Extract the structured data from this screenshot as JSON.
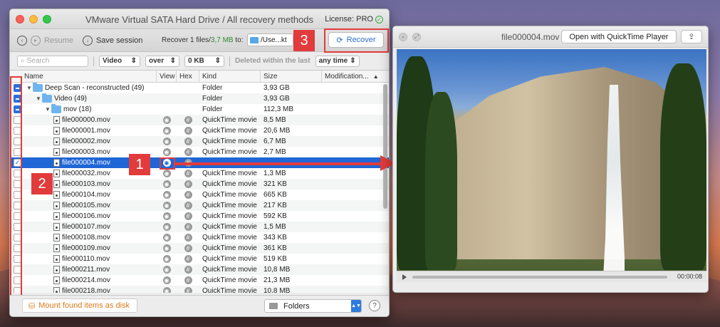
{
  "window": {
    "title": "VMware Virtual SATA Hard Drive / All recovery methods",
    "license": "License: PRO"
  },
  "toolbar": {
    "resume": "Resume",
    "save_session": "Save session",
    "recover_prefix": "Recover 1 files/",
    "recover_size": "3,7 MB",
    "recover_suffix": " to:",
    "path": "/Use...kt",
    "recover_button": "Recover"
  },
  "filters": {
    "search_placeholder": "Search",
    "type": "Video",
    "size_op": "over",
    "size_val": "0 KB",
    "deleted_label": "Deleted within the last",
    "time": "any time"
  },
  "columns": [
    "Name",
    "View",
    "Hex",
    "Kind",
    "Size",
    "Modification..."
  ],
  "rows": [
    {
      "name": "Deep Scan - reconstructed (49)",
      "kind": "Folder",
      "size": "3,93 GB",
      "level": 0,
      "type": "folder",
      "check": "mixed",
      "icons": false
    },
    {
      "name": "Video (49)",
      "kind": "Folder",
      "size": "3,93 GB",
      "level": 1,
      "type": "folder",
      "check": "mixed",
      "icons": false
    },
    {
      "name": "mov (18)",
      "kind": "Folder",
      "size": "112,3 MB",
      "level": 2,
      "type": "folder",
      "check": "mixed",
      "icons": false
    },
    {
      "name": "file000000.mov",
      "kind": "QuickTime movie",
      "size": "8,5 MB",
      "level": 3,
      "type": "file",
      "check": "off",
      "icons": true
    },
    {
      "name": "file000001.mov",
      "kind": "QuickTime movie",
      "size": "20,6 MB",
      "level": 3,
      "type": "file",
      "check": "off",
      "icons": true
    },
    {
      "name": "file000002.mov",
      "kind": "QuickTime movie",
      "size": "6,7 MB",
      "level": 3,
      "type": "file",
      "check": "off",
      "icons": true
    },
    {
      "name": "file000003.mov",
      "kind": "QuickTime movie",
      "size": "2,7 MB",
      "level": 3,
      "type": "file",
      "check": "off",
      "icons": true
    },
    {
      "name": "file000004.mov",
      "kind": "",
      "size": "",
      "level": 3,
      "type": "file",
      "check": "on",
      "icons": true,
      "selected": true
    },
    {
      "name": "file000032.mov",
      "kind": "QuickTime movie",
      "size": "1,3 MB",
      "level": 3,
      "type": "file",
      "check": "off",
      "icons": true
    },
    {
      "name": "file000103.mov",
      "kind": "QuickTime movie",
      "size": "321 KB",
      "level": 3,
      "type": "file",
      "check": "off",
      "icons": true
    },
    {
      "name": "file000104.mov",
      "kind": "QuickTime movie",
      "size": "665 KB",
      "level": 3,
      "type": "file",
      "check": "off",
      "icons": true
    },
    {
      "name": "file000105.mov",
      "kind": "QuickTime movie",
      "size": "217 KB",
      "level": 3,
      "type": "file",
      "check": "off",
      "icons": true
    },
    {
      "name": "file000106.mov",
      "kind": "QuickTime movie",
      "size": "592 KB",
      "level": 3,
      "type": "file",
      "check": "off",
      "icons": true
    },
    {
      "name": "file000107.mov",
      "kind": "QuickTime movie",
      "size": "1,5 MB",
      "level": 3,
      "type": "file",
      "check": "off",
      "icons": true
    },
    {
      "name": "file000108.mov",
      "kind": "QuickTime movie",
      "size": "343 KB",
      "level": 3,
      "type": "file",
      "check": "off",
      "icons": true
    },
    {
      "name": "file000109.mov",
      "kind": "QuickTime movie",
      "size": "361 KB",
      "level": 3,
      "type": "file",
      "check": "off",
      "icons": true
    },
    {
      "name": "file000110.mov",
      "kind": "QuickTime movie",
      "size": "519 KB",
      "level": 3,
      "type": "file",
      "check": "off",
      "icons": true
    },
    {
      "name": "file000211.mov",
      "kind": "QuickTime movie",
      "size": "10,8 MB",
      "level": 3,
      "type": "file",
      "check": "off",
      "icons": true
    },
    {
      "name": "file000214.mov",
      "kind": "QuickTime movie",
      "size": "21,3 MB",
      "level": 3,
      "type": "file",
      "check": "off",
      "icons": true
    },
    {
      "name": "file000218.mov",
      "kind": "QuickTime movie",
      "size": "10,8 MB",
      "level": 3,
      "type": "file",
      "check": "off",
      "icons": true
    }
  ],
  "bottom": {
    "mount": "Mount found items as disk",
    "view_mode": "Folders",
    "help": "?"
  },
  "preview": {
    "filename": "file000004.mov",
    "open_button": "Open with QuickTime Player",
    "time": "00:00:08"
  },
  "callouts": {
    "one": "1",
    "two": "2",
    "three": "3"
  },
  "colors": {
    "accent": "#1f66d6",
    "callout": "#e23b3b",
    "mount": "#d97a1a"
  }
}
